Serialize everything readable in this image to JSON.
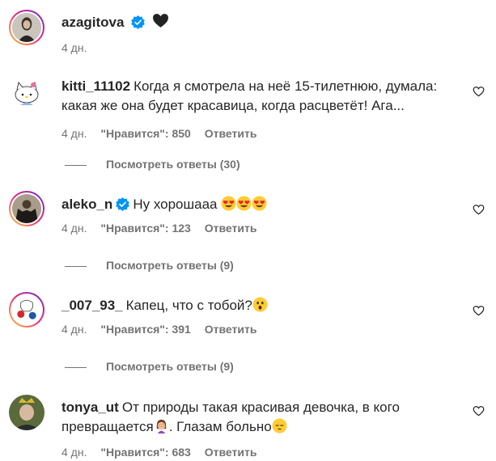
{
  "caption": {
    "username": "azagitova",
    "emoji": "black-heart-emoji",
    "time": "4 дн."
  },
  "comments": [
    {
      "username": "kitti_11102",
      "text": "Когда я смотрела на неё 15-тилетнюю, думала: какая же она будет красавица, когда расцветёт! Ага...",
      "time": "4 дн.",
      "likes": "\"Нравится\": 850",
      "reply": "Ответить",
      "view_replies": "Посмотреть ответы (30)"
    },
    {
      "username": "aleko_n",
      "verified": true,
      "text": "Ну хорошааа",
      "emojis": [
        "heart-eyes-emoji",
        "heart-eyes-emoji",
        "heart-eyes-emoji"
      ],
      "time": "4 дн.",
      "likes": "\"Нравится\": 123",
      "reply": "Ответить",
      "view_replies": "Посмотреть ответы (9)"
    },
    {
      "username": "_007_93_",
      "text": "Капец, что с тобой?",
      "emojis": [
        "astonished-face-emoji"
      ],
      "time": "4 дн.",
      "likes": "\"Нравится\": 391",
      "reply": "Ответить",
      "view_replies": "Посмотреть ответы (9)"
    },
    {
      "username": "tonya_ut",
      "text_part1": "От природы такая красивая девочка, в кого превращается",
      "text_part2": ". Глазам больно",
      "emojis": [
        "woman-facepalming-emoji",
        "pensive-face-emoji"
      ],
      "time": "4 дн.",
      "likes": "\"Нравится\": 683",
      "reply": "Ответить"
    }
  ],
  "colors": {
    "primary_text": "#262626",
    "secondary_text": "#737373",
    "verified_blue": "#0095f6",
    "story_ring": [
      "#f9ce34",
      "#ee2a7b",
      "#6228d7"
    ]
  }
}
